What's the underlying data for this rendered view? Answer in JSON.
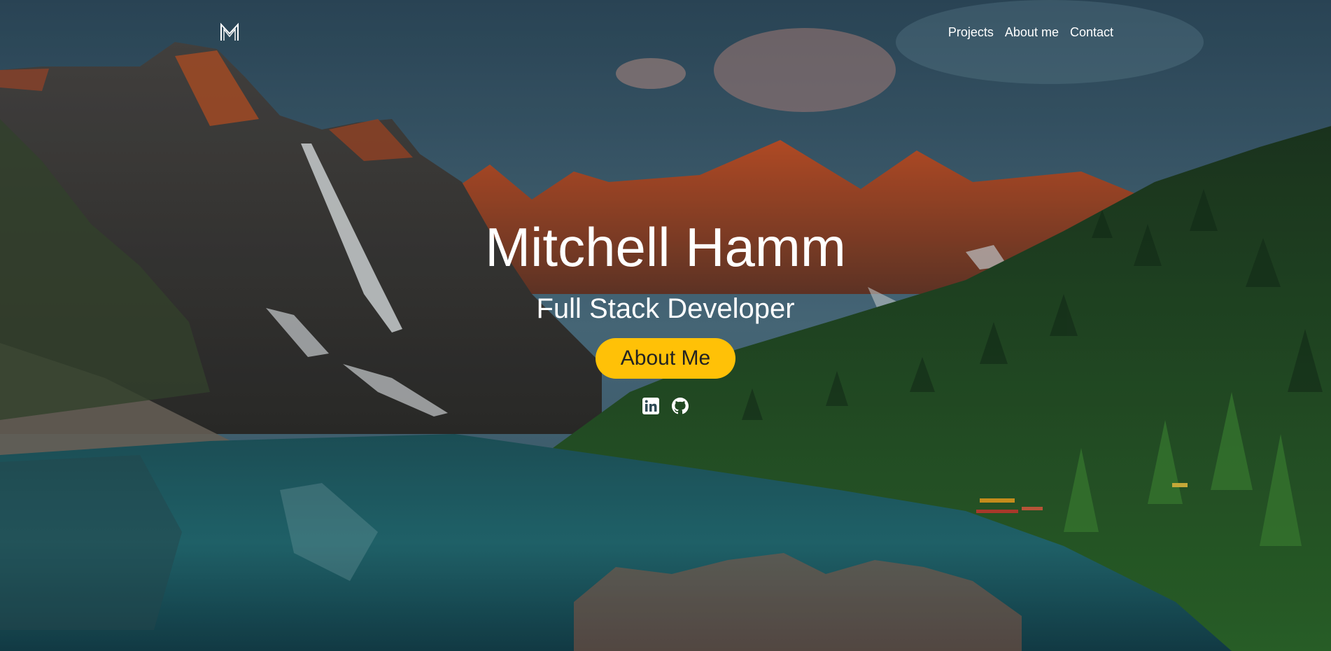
{
  "brand": {
    "logo_icon": "monogram-m-icon"
  },
  "nav": {
    "links": [
      {
        "label": "Projects"
      },
      {
        "label": "About me"
      },
      {
        "label": "Contact"
      }
    ]
  },
  "hero": {
    "name": "Mitchell Hamm",
    "subtitle": "Full Stack Developer",
    "cta_label": "About Me",
    "cta_color": "#ffc107",
    "socials": [
      {
        "icon": "linkedin-icon"
      },
      {
        "icon": "github-icon"
      }
    ]
  }
}
